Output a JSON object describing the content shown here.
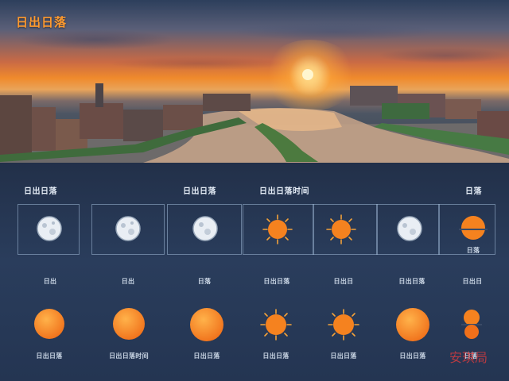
{
  "hero": {
    "title": "日出日落"
  },
  "headers": [
    {
      "key": "h1",
      "text": "日出日落"
    },
    {
      "key": "h2",
      "text": "日出日落"
    },
    {
      "key": "h3",
      "text": "日出日落时间"
    },
    {
      "key": "h4",
      "text": "日落"
    }
  ],
  "top_row": [
    {
      "icon": "moon-icon"
    },
    {
      "icon": "moon-icon"
    },
    {
      "icon": "moon-icon"
    },
    {
      "icon": "sun-icon"
    },
    {
      "icon": "sun-icon"
    },
    {
      "icon": "moon-icon"
    },
    {
      "icon": "sunset-icon",
      "caption": "日落"
    }
  ],
  "mid_labels": [
    "日出",
    "日出",
    "日落",
    "日出日落",
    "日出日",
    "日出日落",
    "日出日"
  ],
  "bottom_row": [
    {
      "icon": "sun-disc-icon",
      "caption": "日出日落"
    },
    {
      "icon": "sun-disc-icon",
      "caption": "日出日落时间"
    },
    {
      "icon": "sun-disc-icon",
      "caption": "日出日落"
    },
    {
      "icon": "sun-icon",
      "caption": "日出日落"
    },
    {
      "icon": "sun-icon",
      "caption": "日出日落"
    },
    {
      "icon": "sun-disc-icon",
      "caption": "日出日落"
    },
    {
      "icon": "sunset-icon",
      "caption": "日落"
    }
  ],
  "watermark": "安琪局",
  "colors": {
    "accent": "#ff9a2e",
    "panel": "#243552",
    "sun": "#f5821f"
  }
}
